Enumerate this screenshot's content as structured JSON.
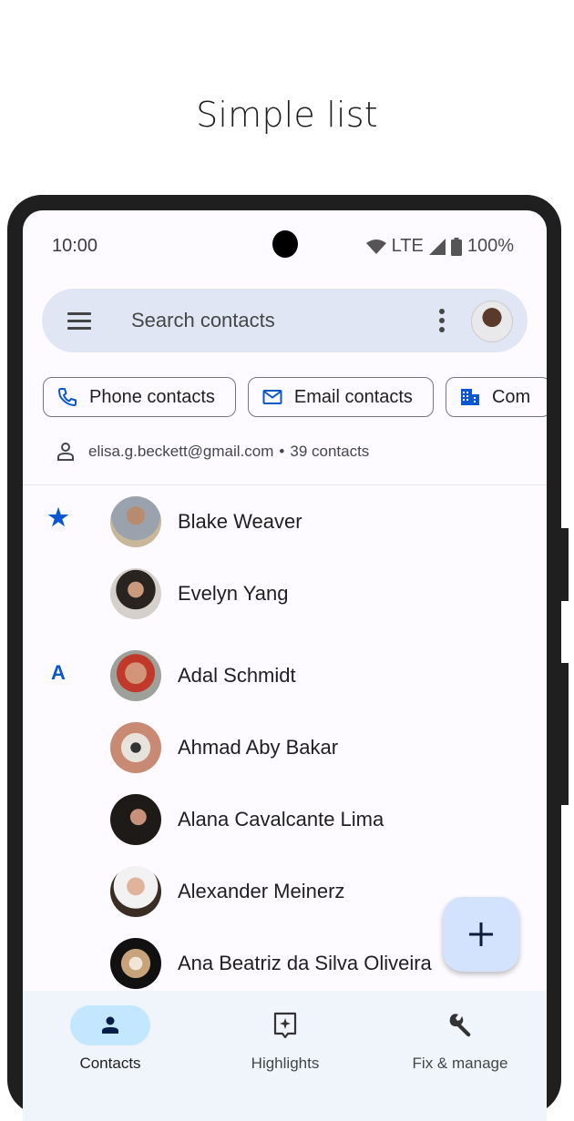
{
  "page": {
    "title": "Simple list"
  },
  "status_bar": {
    "time": "10:00",
    "network": "LTE",
    "battery": "100%"
  },
  "search": {
    "placeholder": "Search contacts"
  },
  "chips": [
    {
      "label": "Phone contacts",
      "icon": "phone-icon"
    },
    {
      "label": "Email contacts",
      "icon": "mail-icon"
    },
    {
      "label": "Com",
      "icon": "business-icon"
    }
  ],
  "account": {
    "email": "elisa.g.beckett@gmail.com",
    "separator": "•",
    "count": "39 contacts"
  },
  "colors": {
    "accent": "#0b57d0",
    "search_bg": "#e1e6f5",
    "fab_bg": "#d3e3fd",
    "nav_active": "#c2e7ff"
  },
  "contacts": [
    {
      "section": "★",
      "name": "Blake Weaver"
    },
    {
      "section": "",
      "name": "Evelyn Yang"
    },
    {
      "section": "A",
      "name": "Adal Schmidt"
    },
    {
      "section": "",
      "name": "Ahmad Aby Bakar"
    },
    {
      "section": "",
      "name": "Alana Cavalcante Lima"
    },
    {
      "section": "",
      "name": "Alexander Meinerz"
    },
    {
      "section": "",
      "name": "Ana Beatriz da Silva Oliveira"
    }
  ],
  "fab": {
    "icon": "plus-icon"
  },
  "bottom_nav": [
    {
      "label": "Contacts",
      "icon": "person-icon",
      "active": true
    },
    {
      "label": "Highlights",
      "icon": "highlights-icon",
      "active": false
    },
    {
      "label": "Fix & manage",
      "icon": "wrench-icon",
      "active": false
    }
  ]
}
